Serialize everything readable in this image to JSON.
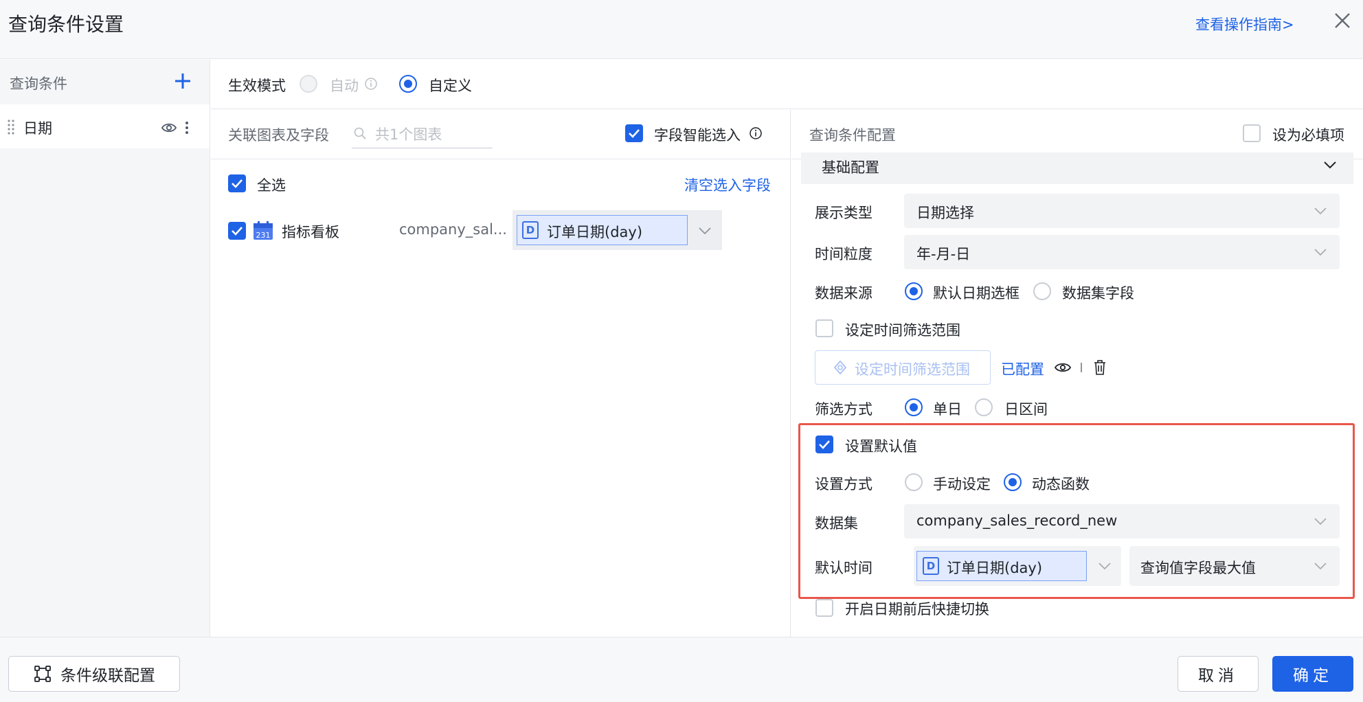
{
  "header": {
    "title": "查询条件设置",
    "guide_link": "查看操作指南>"
  },
  "sidebar": {
    "heading": "查询条件",
    "items": [
      {
        "label": "日期"
      }
    ]
  },
  "mode": {
    "label": "生效模式",
    "options": [
      "自动",
      "自定义"
    ],
    "selected": "自定义"
  },
  "linked": {
    "label": "关联图表及字段",
    "search_placeholder": "共1个图表",
    "smart_select_label": "字段智能选入",
    "smart_select_checked": true,
    "select_all_label": "全选",
    "clear_link": "清空选入字段",
    "rows": [
      {
        "chart": "指标看板",
        "calendar_icon_text": "231",
        "dataset": "company_sal...",
        "field": "订单日期(day)",
        "field_type_icon": "D"
      }
    ]
  },
  "config": {
    "heading": "查询条件配置",
    "required_label": "设为必填项",
    "section_title": "基础配置",
    "display_type": {
      "label": "展示类型",
      "value": "日期选择"
    },
    "granularity": {
      "label": "时间粒度",
      "value": "年-月-日"
    },
    "data_source": {
      "label": "数据来源",
      "options": [
        "默认日期选框",
        "数据集字段"
      ],
      "selected": "默认日期选框"
    },
    "time_range": {
      "label": "设定时间筛选范围",
      "button": "设定时间筛选范围",
      "status": "已配置"
    },
    "filter_mode": {
      "label": "筛选方式",
      "options": [
        "单日",
        "日区间"
      ],
      "selected": "单日"
    },
    "default_value": {
      "label": "设置默认值",
      "method_label": "设置方式",
      "method_options": [
        "手动设定",
        "动态函数"
      ],
      "method_selected": "动态函数",
      "dataset_label": "数据集",
      "dataset_value": "company_sales_record_new",
      "time_label": "默认时间",
      "time_field": "订单日期(day)",
      "time_func": "查询值字段最大值"
    },
    "quick_switch": "开启日期前后快捷切换"
  },
  "footer": {
    "cascade_button": "条件级联配置",
    "cancel_button": "取消",
    "ok_button": "确定"
  },
  "colors": {
    "primary": "#1e62e6",
    "highlight": "#e9564b"
  }
}
